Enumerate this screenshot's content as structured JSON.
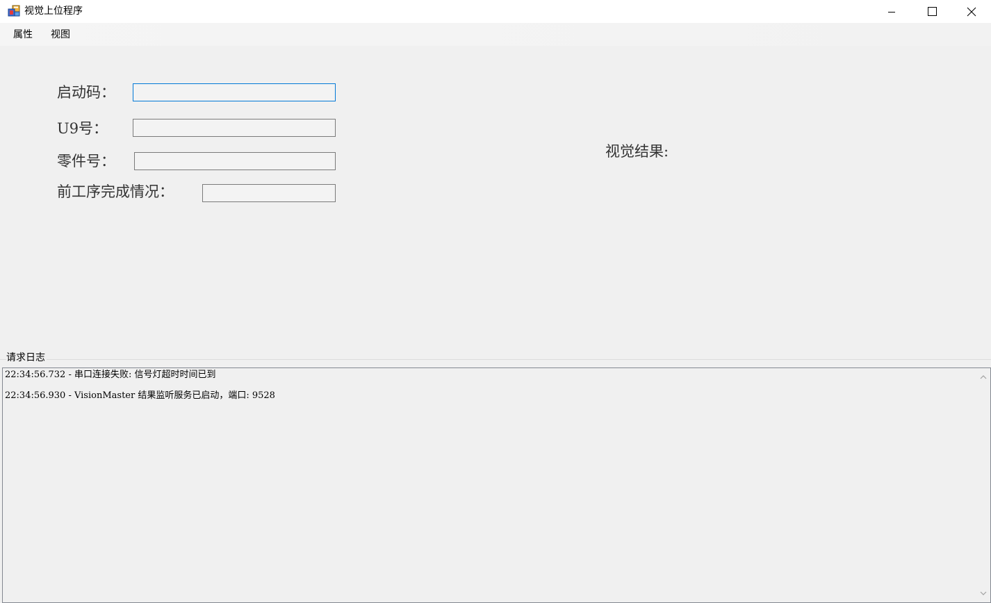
{
  "window": {
    "title": "视觉上位程序"
  },
  "menu": {
    "items": [
      {
        "label": "属性"
      },
      {
        "label": "视图"
      }
    ]
  },
  "form": {
    "start_code_label": "启动码：",
    "start_code_value": "",
    "u9_label": "U9号：",
    "u9_value": "",
    "part_no_label": "零件号：",
    "part_no_value": "",
    "prev_process_label": "前工序完成情况：",
    "prev_process_value": "",
    "vision_result_label": "视觉结果:"
  },
  "log": {
    "group_title": "请求日志",
    "lines": [
      "22:34:56.732 - 串口连接失败: 信号灯超时时间已到",
      "22:34:56.930 - VisionMaster 结果监听服务已启动，端口: 9528"
    ]
  },
  "icons": {
    "app": "app-icon",
    "minimize": "minimize-icon",
    "maximize": "maximize-icon",
    "close": "close-icon",
    "scroll_up": "chevron-up-icon",
    "scroll_down": "chevron-down-icon"
  },
  "colors": {
    "focus_border": "#0078d7",
    "window_bg": "#f0f0f0"
  }
}
